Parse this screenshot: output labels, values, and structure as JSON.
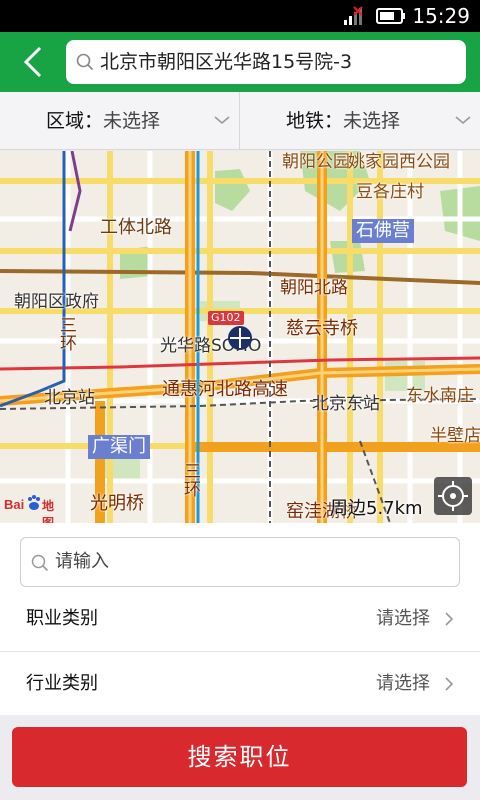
{
  "status_bar": {
    "time": "15:29"
  },
  "header": {
    "search_value": "北京市朝阳区光华路15号院-3"
  },
  "filters": {
    "area_label": "区域：",
    "area_value": "未选择",
    "subway_label": "地铁：",
    "subway_value": "未选择"
  },
  "map": {
    "labels": {
      "chaoyang_park": "朝阳公园",
      "yaojiayuan": "姚家园西公园",
      "dougezhuang": "豆各庄村",
      "gongti": "工体北路",
      "shifoying": "石佛营",
      "chaoyang_bei": "朝阳北路",
      "chaoyang_gov": "朝阳区政府",
      "g102": "G102",
      "ciyunsi": "慈云寺桥",
      "huan_1a": "三",
      "huan_1b": "环",
      "guanghua": "光华路SOHO",
      "tonghui": "通惠河北路高速",
      "beijing_station": "北京站",
      "beijing_east": "北京东站",
      "dongshui": "东水南庄",
      "guangqumen": "广渠门",
      "banbidian": "半壁店",
      "huan_2a": "三",
      "huan_2b": "环",
      "guangming": "光明桥",
      "yaowa": "窑洼湖桥"
    },
    "range_text": "周边5.7km",
    "logo_bai": "Bai",
    "logo_ditu": "地图"
  },
  "form": {
    "keyword_placeholder": "请输入",
    "job_category_label": "职业类别",
    "job_category_value": "请选择",
    "industry_label": "行业类别",
    "industry_value": "请选择"
  },
  "button": {
    "search_label": "搜索职位"
  },
  "colors": {
    "header": "#18a445",
    "button": "#d8292f",
    "metro_badge": "#6a7fd0",
    "ring_road": "#f2a11e"
  }
}
